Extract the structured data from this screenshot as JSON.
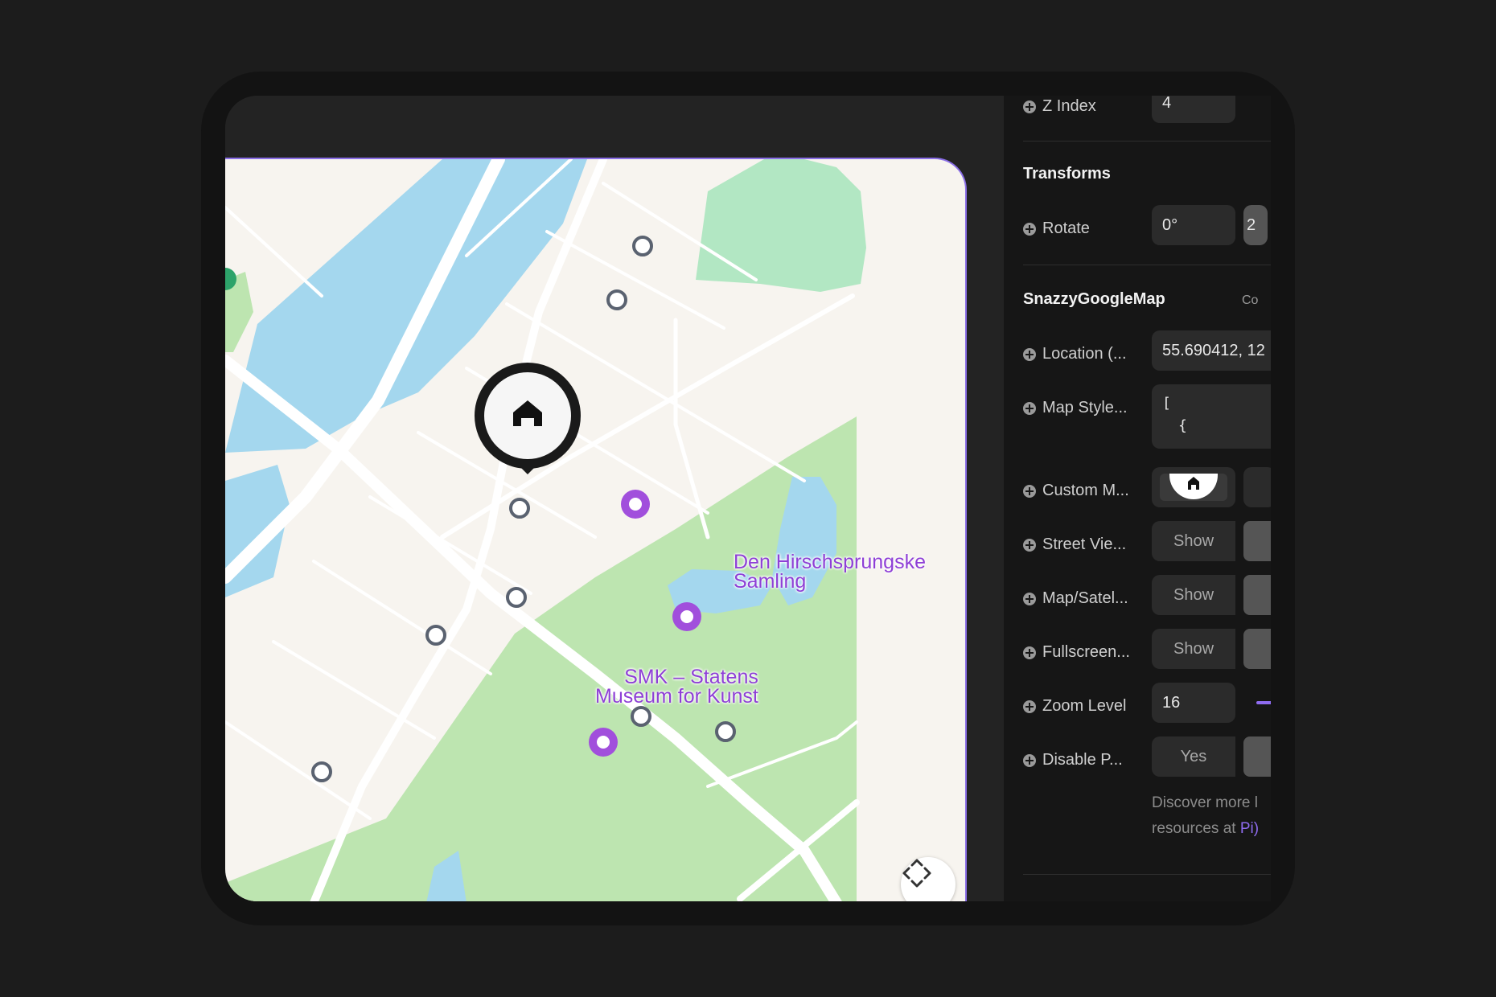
{
  "panel": {
    "z_index": {
      "label": "Z Index",
      "value": "4"
    },
    "transforms": {
      "title": "Transforms",
      "rotate": {
        "label": "Rotate",
        "value": "0°",
        "extra": "2"
      }
    },
    "component": {
      "title": "SnazzyGoogleMap",
      "right_hint": "Co",
      "rows": [
        {
          "label": "Location (...",
          "type": "text",
          "value": "55.690412, 12"
        },
        {
          "label": "Map Style...",
          "type": "code",
          "value": "[",
          "value2": "{"
        },
        {
          "label": "Custom M...",
          "type": "image",
          "value": ""
        },
        {
          "label": "Street Vie...",
          "type": "toggle",
          "value": "Show"
        },
        {
          "label": "Map/Satel...",
          "type": "toggle",
          "value": "Show"
        },
        {
          "label": "Fullscreen...",
          "type": "toggle",
          "value": "Show"
        },
        {
          "label": "Zoom Level",
          "type": "slider",
          "value": "16"
        },
        {
          "label": "Disable P...",
          "type": "toggle",
          "value": "Yes"
        }
      ],
      "note_line1": "Discover more l",
      "note_line2_prefix": "resources at ",
      "note_link": "Pi)"
    }
  },
  "map": {
    "marker_icon": "home-icon",
    "pois": [
      {
        "line1": "Den Hirschsprungske",
        "line2": "Samling"
      },
      {
        "line1": "SMK – Statens",
        "line2": "Museum for Kunst"
      }
    ],
    "fullscreen_icon": "fullscreen-arrows-icon",
    "colors": {
      "water": "#a4d7ee",
      "park": "#bde5b0",
      "land": "#f7f4ef",
      "poi": "#8e3fd6",
      "accent": "#8a6ee6"
    }
  }
}
